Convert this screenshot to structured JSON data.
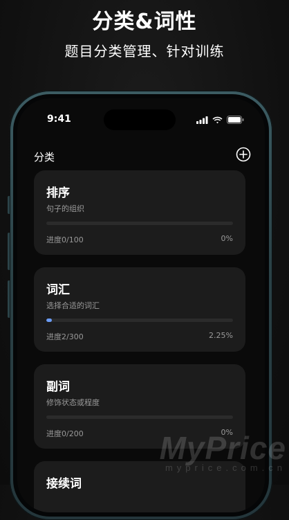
{
  "promo": {
    "title": "分类&词性",
    "subtitle": "题目分类管理、针对训练"
  },
  "status_bar": {
    "time": "9:41",
    "icons": [
      "signal-icon",
      "wifi-icon",
      "battery-icon"
    ]
  },
  "header": {
    "title": "分类",
    "add_icon": "add-circle-icon"
  },
  "cards": [
    {
      "title": "排序",
      "subtitle": "句子的组织",
      "progress_label": "进度0/100",
      "percent": "0%",
      "progress_fraction": 0
    },
    {
      "title": "词汇",
      "subtitle": "选择合适的词汇",
      "progress_label": "进度2/300",
      "percent": "2.25%",
      "progress_fraction": 0.0225
    },
    {
      "title": "副词",
      "subtitle": "修饰状态或程度",
      "progress_label": "进度0/200",
      "percent": "0%",
      "progress_fraction": 0
    },
    {
      "title": "接续词"
    }
  ],
  "colors": {
    "accent": "#6b9cf5",
    "card_bg": "#1c1c1c",
    "frame": "#2b4247"
  },
  "watermark": {
    "main": "MyPrice",
    "sub": "myprice.com.cn"
  }
}
